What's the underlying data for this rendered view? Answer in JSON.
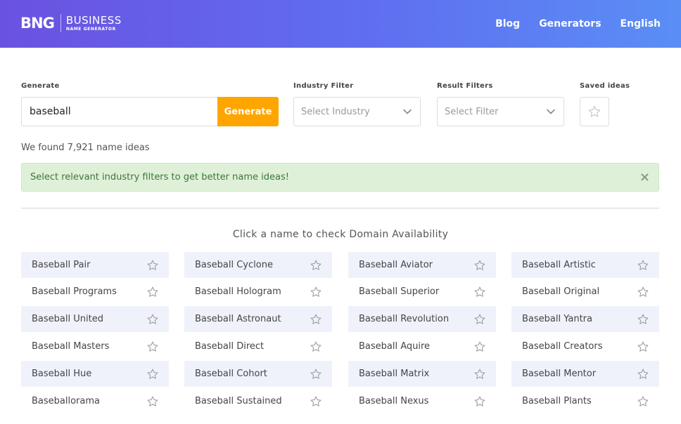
{
  "header": {
    "logo_mark": "BNG",
    "logo_title": "BUSINESS",
    "logo_subtitle": "NAME GENERATOR",
    "nav": [
      "Blog",
      "Generators",
      "English"
    ]
  },
  "filters": {
    "generate_label": "Generate",
    "search_value": "baseball",
    "generate_button": "Generate",
    "industry_label": "Industry Filter",
    "industry_placeholder": "Select Industry",
    "result_label": "Result Filters",
    "result_placeholder": "Select Filter",
    "saved_label": "Saved ideas"
  },
  "results": {
    "found_text": "We found 7,921 name ideas",
    "alert_text": "Select relevant industry filters to get better name ideas!",
    "alert_close": "×",
    "hint": "Click a name to check Domain Availability",
    "names": [
      [
        "Baseball Pair",
        "Baseball Cyclone",
        "Baseball Aviator",
        "Baseball Artistic"
      ],
      [
        "Baseball Programs",
        "Baseball Hologram",
        "Baseball Superior",
        "Baseball Original"
      ],
      [
        "Baseball United",
        "Baseball Astronaut",
        "Baseball Revolution",
        "Baseball Yantra"
      ],
      [
        "Baseball Masters",
        "Baseball Direct",
        "Baseball Aquire",
        "Baseball Creators"
      ],
      [
        "Baseball Hue",
        "Baseball Cohort",
        "Baseball Matrix",
        "Baseball Mentor"
      ],
      [
        "Baseballorama",
        "Baseball Sustained",
        "Baseball Nexus",
        "Baseball Plants"
      ]
    ]
  },
  "colors": {
    "header_start": "#6a52e0",
    "header_end": "#5a8ef5",
    "accent": "#ffa500",
    "alert_bg": "#dff0d8",
    "card_bg": "#eff2fb"
  },
  "icons": {
    "save": "star-outline-icon",
    "dropdown": "chevron-down-icon",
    "dismiss": "close-icon"
  }
}
